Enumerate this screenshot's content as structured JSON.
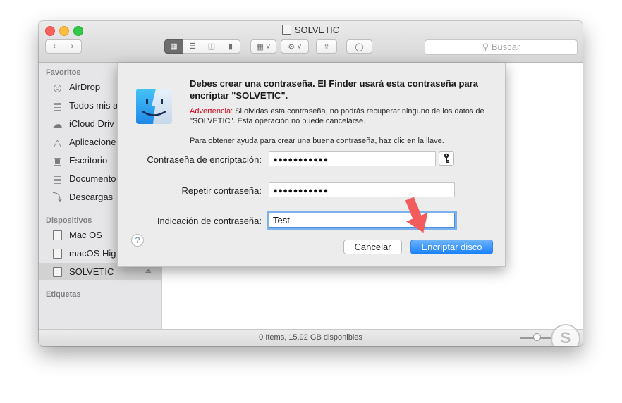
{
  "window": {
    "title": "SOLVETIC",
    "search_placeholder": "Buscar",
    "status_text": "0 ítems, 15,92 GB disponibles"
  },
  "toolbar": {
    "view_modes": [
      "grid-view-icon",
      "list-view-icon",
      "column-view-icon",
      "coverflow-view-icon"
    ],
    "active_view": "grid-view-icon"
  },
  "sidebar": {
    "favorites_header": "Favoritos",
    "favorites": [
      {
        "label": "AirDrop",
        "icon": "airdrop-icon"
      },
      {
        "label": "Todos mis a",
        "icon": "all-files-icon"
      },
      {
        "label": "iCloud Driv",
        "icon": "cloud-icon"
      },
      {
        "label": "Aplicacione",
        "icon": "applications-icon"
      },
      {
        "label": "Escritorio",
        "icon": "desktop-icon"
      },
      {
        "label": "Documento",
        "icon": "documents-icon"
      },
      {
        "label": "Descargas",
        "icon": "downloads-icon"
      }
    ],
    "devices_header": "Dispositivos",
    "devices": [
      {
        "label": "Mac OS",
        "icon": "hard-disk-icon"
      },
      {
        "label": "macOS Hig",
        "icon": "hard-disk-icon"
      },
      {
        "label": "SOLVETIC",
        "icon": "external-disk-icon",
        "selected": true
      }
    ],
    "tags_header": "Etiquetas"
  },
  "dialog": {
    "title": "Debes crear una contraseña. El Finder usará esta contraseña para encriptar \"SOLVETIC\".",
    "warning_label": "Advertencia:",
    "warning_text": " Si olvidas esta contraseña, no podrás recuperar ninguno de los datos de \"SOLVETIC\". Esta operación no puede cancelarse.",
    "help_text": "Para obtener ayuda para crear una buena contraseña, haz clic en la llave.",
    "password_label": "Contraseña de encriptación:",
    "password_value": "●●●●●●●●●●●",
    "repeat_label": "Repetir contraseña:",
    "repeat_value": "●●●●●●●●●●●",
    "hint_label": "Indicación de contraseña:",
    "hint_value": "Test",
    "help_button": "?",
    "cancel_label": "Cancelar",
    "confirm_label": "Encriptar disco"
  },
  "colors": {
    "accent": "#1a82fb",
    "warning": "#d0021b",
    "annotation_arrow": "#f25c5c"
  }
}
